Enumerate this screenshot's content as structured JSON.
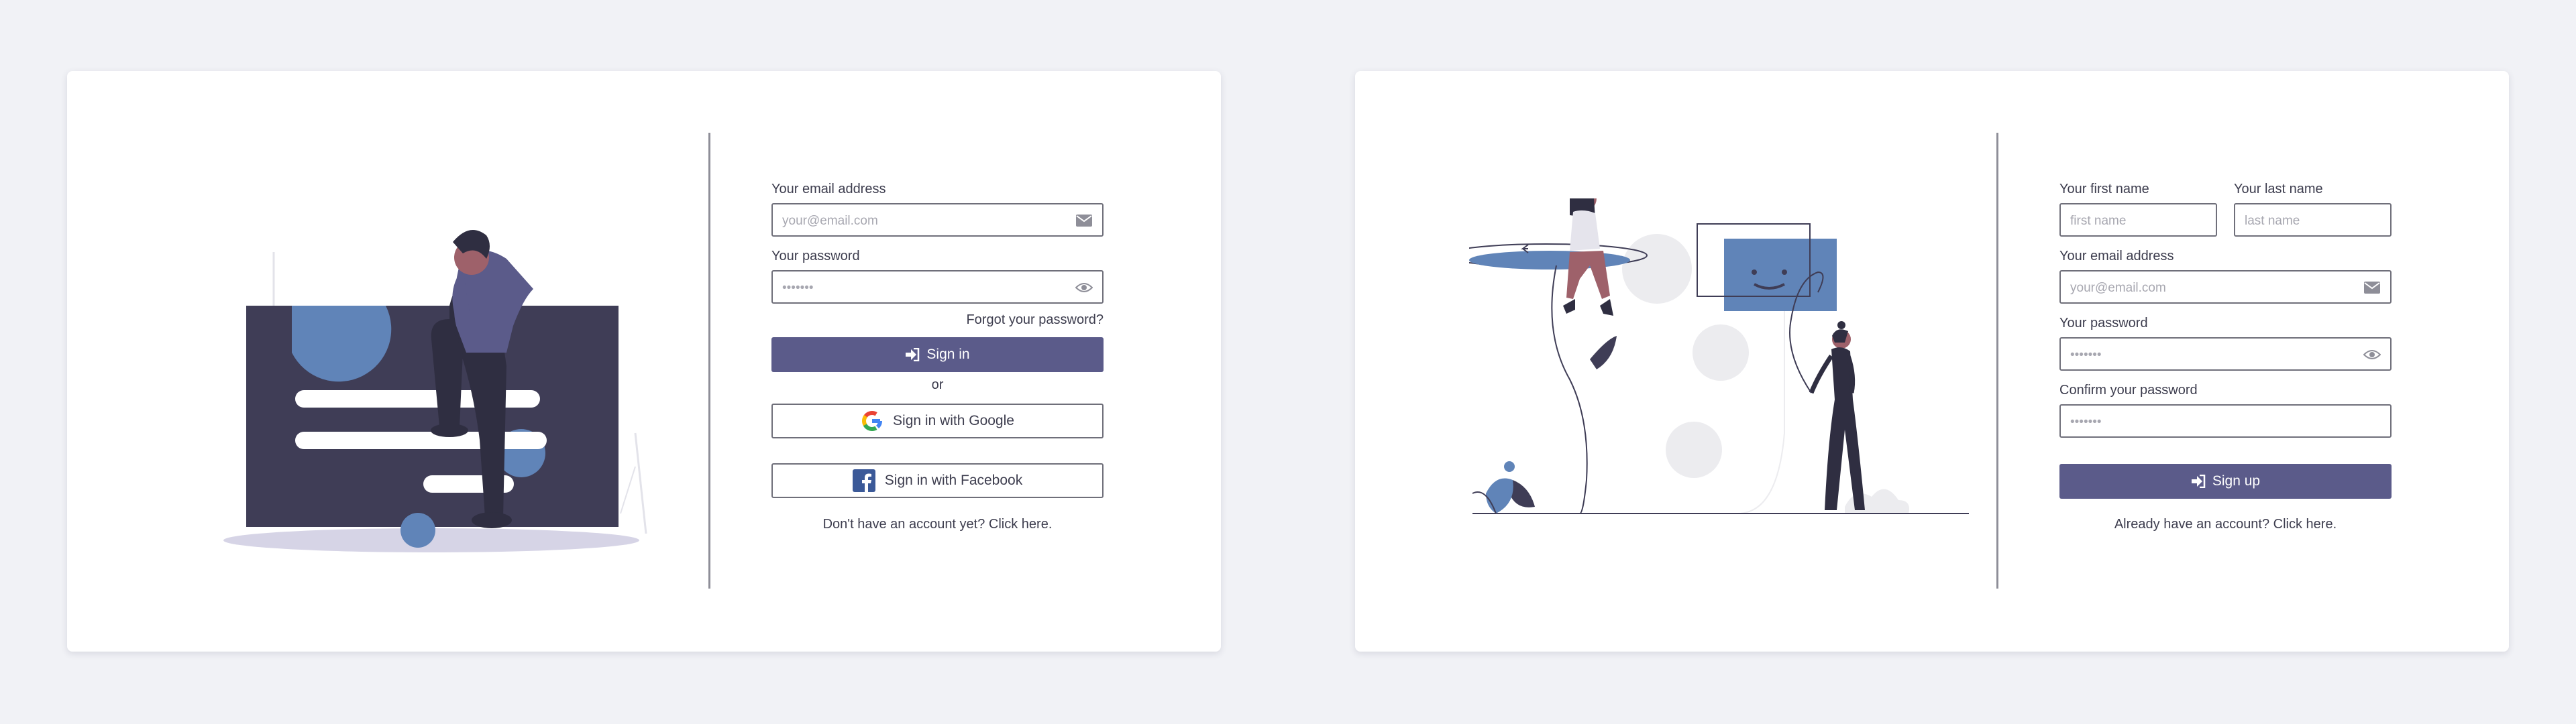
{
  "colors": {
    "background": "#f1f2f6",
    "card": "#ffffff",
    "accent": "#5b5b8a",
    "border": "#6f6f7a",
    "illustration_dark": "#3f3d56",
    "illustration_blue": "#6084b8"
  },
  "login": {
    "email_label": "Your email address",
    "email_placeholder": "your@email.com",
    "email_icon": "envelope-icon",
    "password_label": "Your password",
    "password_placeholder": "•••••••",
    "password_icon": "eye-icon",
    "forgot_link": "Forgot your password?",
    "sign_in_label": "Sign in",
    "sign_in_icon": "sign-in-icon",
    "or_text": "or",
    "google_label": "Sign in with Google",
    "facebook_label": "Sign in with Facebook",
    "signup_link": "Don't have an account yet? Click here."
  },
  "signup": {
    "first_name_label": "Your first name",
    "first_name_placeholder": "first name",
    "last_name_label": "Your last name",
    "last_name_placeholder": "last name",
    "email_label": "Your email address",
    "email_placeholder": "your@email.com",
    "password_label": "Your password",
    "password_placeholder": "•••••••",
    "confirm_label": "Confirm your password",
    "confirm_placeholder": "•••••••",
    "sign_up_label": "Sign up",
    "signin_link": "Already have an account? Click here."
  }
}
